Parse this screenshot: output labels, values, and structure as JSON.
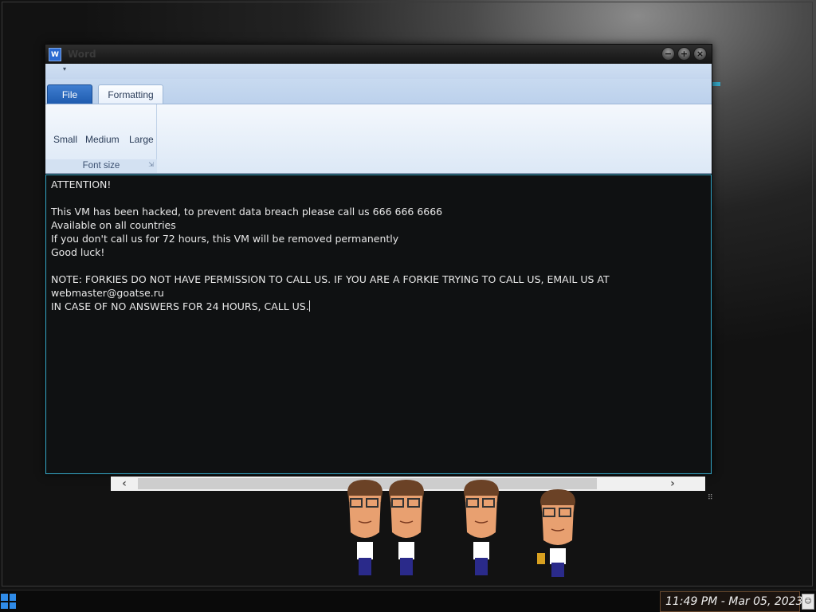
{
  "window": {
    "title": "Word",
    "icon_letter": "W",
    "controls": {
      "minimize": "−",
      "maximize": "+",
      "close": "×"
    },
    "qat_dropdown": "▾"
  },
  "ribbon": {
    "tabs": [
      {
        "label": "File"
      },
      {
        "label": "Formatting"
      }
    ],
    "font_size_group": {
      "label": "Font size",
      "buttons": [
        "Small",
        "Medium",
        "Large"
      ],
      "launcher": "⇲"
    }
  },
  "document": {
    "lines": [
      "ATTENTION!",
      "",
      "This VM has been hacked, to prevent data breach please call us 666 666 6666",
      "Available on all countries",
      "If you don't call us for 72 hours, this VM will be removed permanently",
      "Good luck!",
      "",
      "NOTE: FORKIES DO NOT HAVE PERMISSION TO CALL US. IF YOU ARE A FORKIE TRYING TO CALL US, EMAIL US AT",
      "webmaster@goatse.ru",
      "IN CASE OF NO ANSWERS FOR 24 HOURS, CALL US."
    ]
  },
  "scrollbar": {
    "left_arrow": "‹",
    "right_arrow": "›"
  },
  "taskbar": {
    "clock": "11:49 PM - Mar 05, 2023",
    "tray_icon": "person-icon",
    "start_icon": "windows-start-icon"
  },
  "colors": {
    "editor_bg": "#0f1112",
    "editor_text": "#e8e8e8",
    "editor_border": "#34a6c6",
    "ribbon_bg": "#dce8f6",
    "file_tab": "#2b6ad1"
  }
}
